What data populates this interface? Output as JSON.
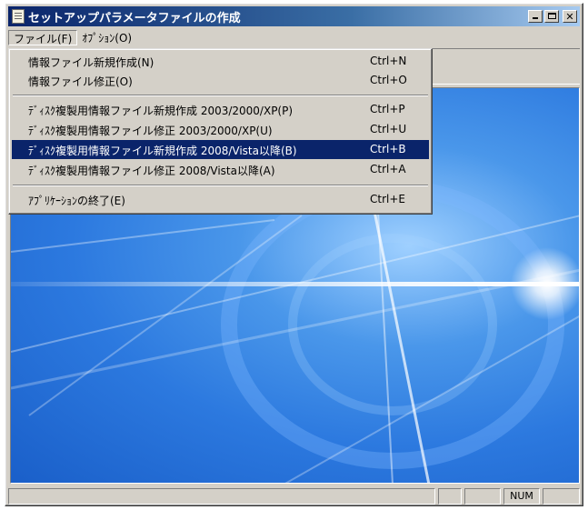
{
  "window": {
    "title": "セットアップパラメータファイルの作成",
    "icon": "document-icon",
    "close_glyph": "✕"
  },
  "menubar": [
    {
      "label": "ファイル(F)",
      "active": true
    },
    {
      "label": "ｵﾌﾟｼｮﾝ(O)",
      "active": false
    }
  ],
  "file_menu": {
    "items": [
      {
        "label": "情報ファイル新規作成(N)",
        "shortcut": "Ctrl+N"
      },
      {
        "label": "情報ファイル修正(O)",
        "shortcut": "Ctrl+O"
      },
      {
        "label": "ﾃﾞｨｽｸ複製用情報ファイル新規作成 2003/2000/XP(P)",
        "shortcut": "Ctrl+P"
      },
      {
        "label": "ﾃﾞｨｽｸ複製用情報ファイル修正 2003/2000/XP(U)",
        "shortcut": "Ctrl+U"
      },
      {
        "label": "ﾃﾞｨｽｸ複製用情報ファイル新規作成 2008/Vista以降(B)",
        "shortcut": "Ctrl+B",
        "highlighted": true
      },
      {
        "label": "ﾃﾞｨｽｸ複製用情報ファイル修正 2008/Vista以降(A)",
        "shortcut": "Ctrl+A"
      },
      {
        "label": "ｱﾌﾟﾘｹｰｼｮﾝの終了(E)",
        "shortcut": "Ctrl+E"
      }
    ]
  },
  "statusbar": {
    "num_indicator": "NUM"
  },
  "colors": {
    "titlebar_start": "#0a246a",
    "titlebar_end": "#a6caf0",
    "menu_highlight": "#0a246a",
    "face": "#d4d0c8"
  }
}
